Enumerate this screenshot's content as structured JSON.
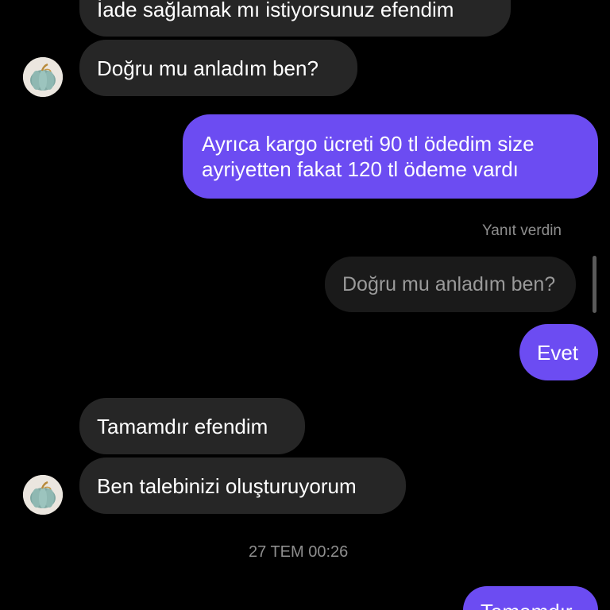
{
  "colors": {
    "outgoing": "#6c4cf2",
    "incoming": "#262626",
    "background": "#000000"
  },
  "messages": {
    "m1": "İade sağlamak mı istiyorsunuz efendim",
    "m2": "Doğru mu anladım ben?",
    "m3_line1": "Ayrıca kargo ücreti 90 tl ödedim size",
    "m3_line2": "ayriyetten fakat 120 tl ödeme vardı",
    "reply_label": "Yanıt verdin",
    "reply_quote": "Doğru mu anladım ben?",
    "m4": "Evet",
    "m5": "Tamamdır efendim",
    "m6": "Ben talebinizi oluşturuyorum",
    "timestamp": "27 TEM 00:26",
    "m7": "Tamamdır"
  },
  "icons": {
    "avatar": "pumpkin-avatar-icon"
  }
}
